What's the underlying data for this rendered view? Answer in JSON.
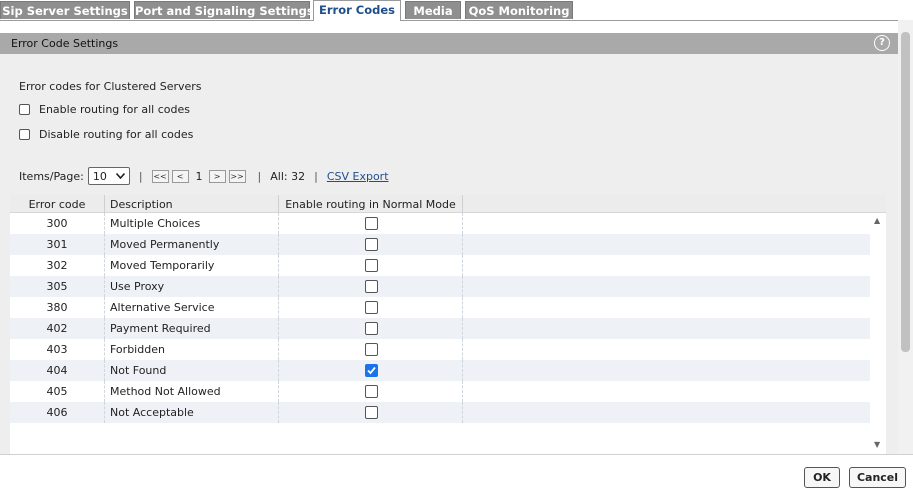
{
  "tabs": [
    {
      "label": "Sip Server Settings",
      "active": false
    },
    {
      "label": "Port and Signaling Settings",
      "active": false
    },
    {
      "label": "Error Codes",
      "active": true
    },
    {
      "label": "Media",
      "active": false
    },
    {
      "label": "QoS Monitoring",
      "active": false
    }
  ],
  "panel": {
    "title": "Error Code Settings",
    "help_icon": "?"
  },
  "section": {
    "title": "Error codes for Clustered Servers",
    "enable_all_label": "Enable routing for all codes",
    "disable_all_label": "Disable routing for all codes"
  },
  "pager": {
    "items_label": "Items/Page:",
    "items_value": "10",
    "first": "<<",
    "prev": "<",
    "page": "1",
    "next": ">",
    "last": ">>",
    "total": "All: 32",
    "csv_export": "CSV Export"
  },
  "table": {
    "headers": [
      "Error code",
      "Description",
      "Enable routing in Normal Mode"
    ],
    "rows": [
      {
        "code": "300",
        "desc": "Multiple Choices",
        "enabled": false
      },
      {
        "code": "301",
        "desc": "Moved Permanently",
        "enabled": false
      },
      {
        "code": "302",
        "desc": "Moved Temporarily",
        "enabled": false
      },
      {
        "code": "305",
        "desc": "Use Proxy",
        "enabled": false
      },
      {
        "code": "380",
        "desc": "Alternative Service",
        "enabled": false
      },
      {
        "code": "402",
        "desc": "Payment Required",
        "enabled": false
      },
      {
        "code": "403",
        "desc": "Forbidden",
        "enabled": false
      },
      {
        "code": "404",
        "desc": "Not Found",
        "enabled": true
      },
      {
        "code": "405",
        "desc": "Method Not Allowed",
        "enabled": false
      },
      {
        "code": "406",
        "desc": "Not Acceptable",
        "enabled": false
      }
    ]
  },
  "buttons": {
    "ok": "OK",
    "cancel": "Cancel"
  },
  "colors": {
    "accent": "#1f4f8a",
    "checked": "#1a73e8",
    "tab_inactive": "#8f8f8f",
    "header_bar": "#a9a9a9"
  }
}
